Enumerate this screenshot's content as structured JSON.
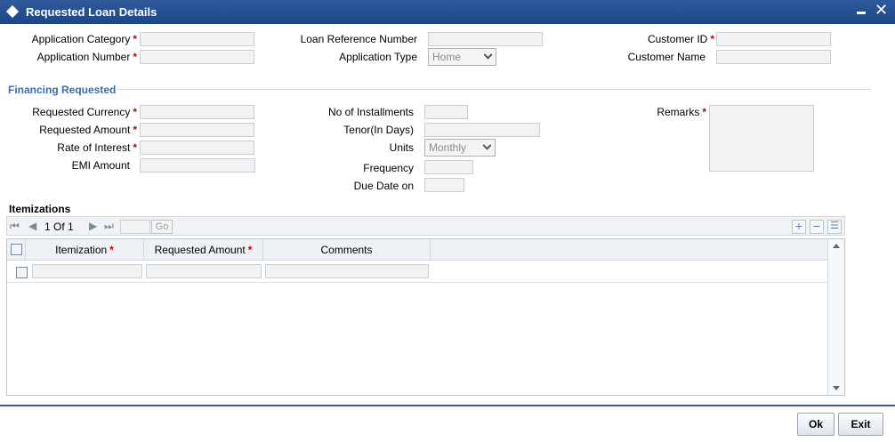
{
  "window": {
    "title": "Requested Loan Details"
  },
  "header_fields": {
    "application_category": "Application Category",
    "application_number": "Application Number",
    "loan_reference_number": "Loan Reference Number",
    "application_type": "Application Type",
    "application_type_value": "Home",
    "customer_id": "Customer ID",
    "customer_name": "Customer Name",
    "required_mark": "*"
  },
  "financing": {
    "section_title": "Financing Requested",
    "requested_currency": "Requested Currency",
    "requested_amount": "Requested Amount",
    "rate_of_interest": "Rate of Interest",
    "emi_amount": "EMI Amount",
    "no_of_installments": "No of Installments",
    "tenor": "Tenor(In Days)",
    "units": "Units",
    "units_value": "Monthly",
    "frequency": "Frequency",
    "due_date_on": "Due Date on",
    "remarks": "Remarks"
  },
  "itemizations": {
    "title": "Itemizations",
    "pager_label": "1 Of 1",
    "go_label": "Go",
    "columns": [
      "Itemization",
      "Requested Amount",
      "Comments"
    ],
    "add_glyph": "+",
    "delete_glyph": "−",
    "view_glyph": "☰"
  },
  "footer": {
    "ok_label": "Ok",
    "exit_label": "Exit"
  },
  "icons": {
    "window": "diamond-icon",
    "minimize": "minimize-icon",
    "close": "close-icon",
    "first": "first-page-icon",
    "prev": "previous-page-icon",
    "next": "next-page-icon",
    "last": "last-page-icon"
  },
  "colors": {
    "titlebar": "#1d4687",
    "section": "#3b6bb1",
    "required": "#cc0000"
  }
}
